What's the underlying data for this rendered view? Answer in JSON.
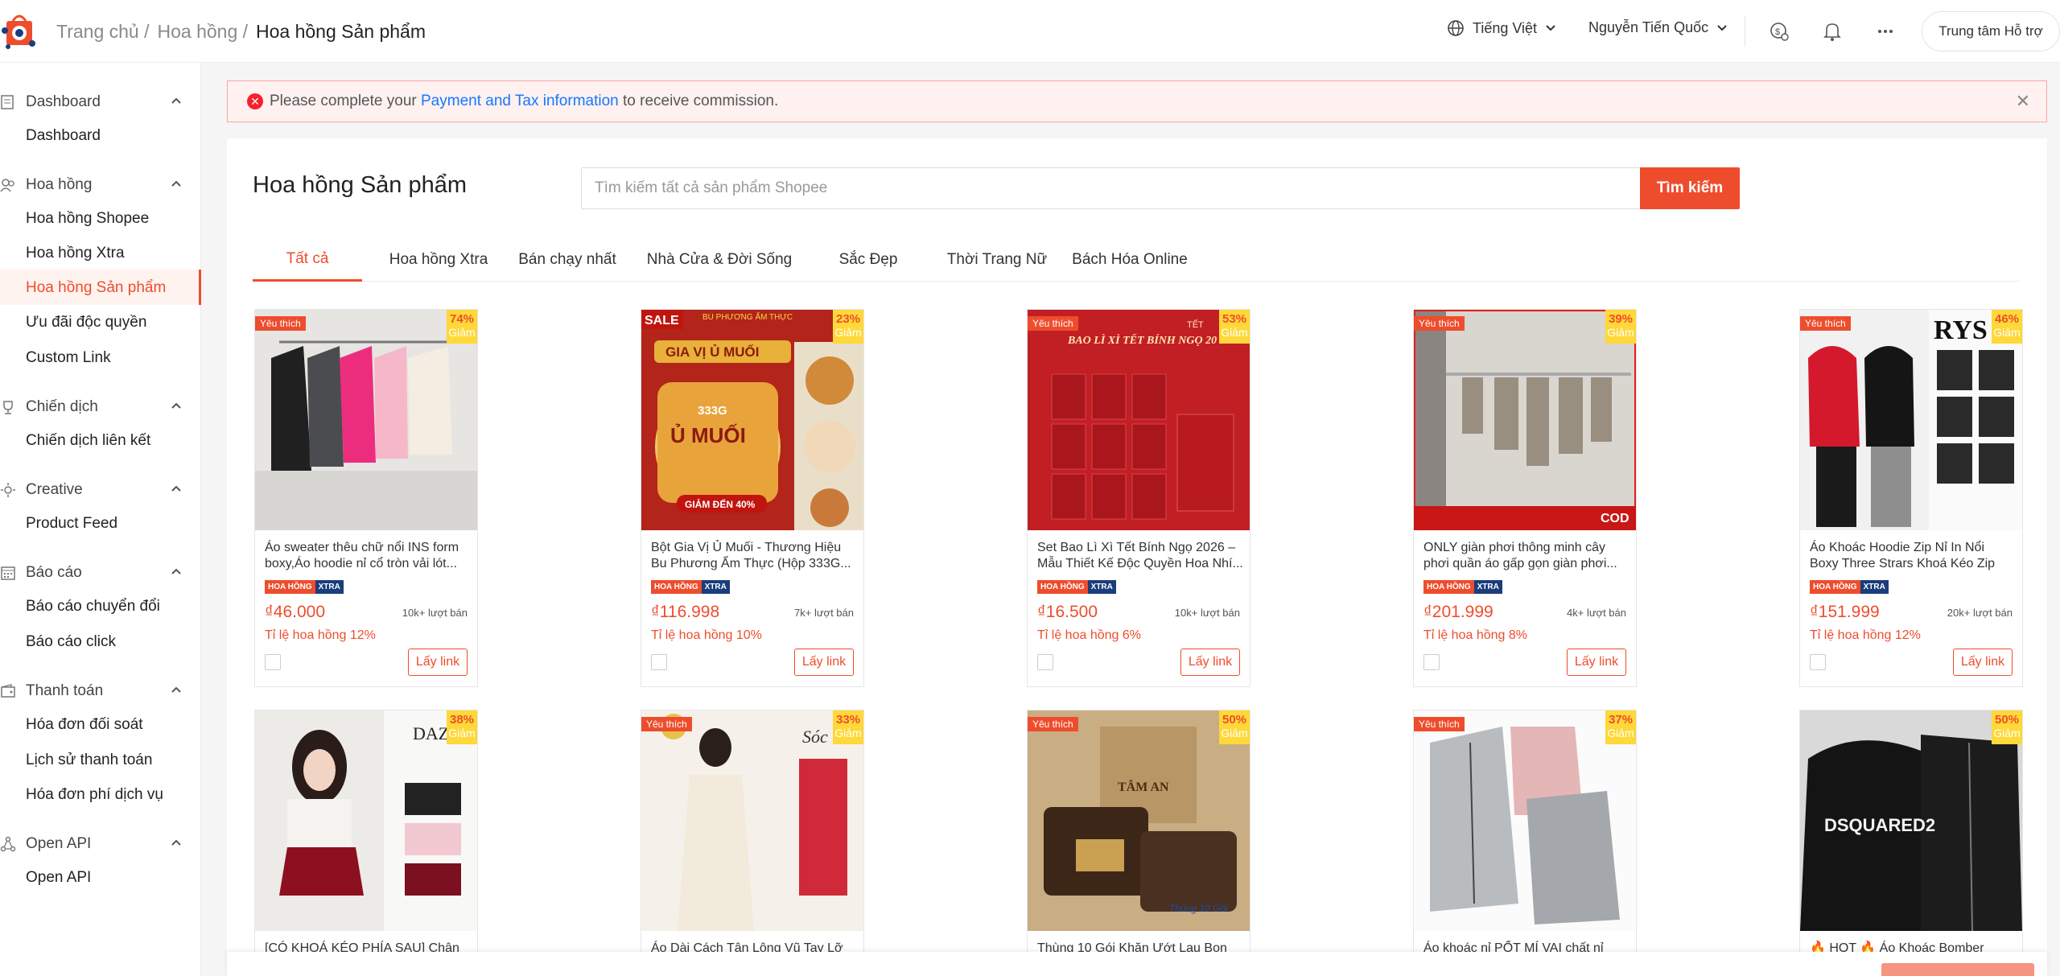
{
  "header": {
    "breadcrumb": [
      "Trang chủ /",
      "Hoa hồng /",
      "Hoa hồng Sản phẩm"
    ],
    "language": "Tiếng Việt",
    "user": "Nguyễn Tiến Quốc",
    "help": "Trung tâm Hỗ trợ"
  },
  "sidebar": {
    "sections": [
      {
        "title": "Dashboard",
        "items": [
          "Dashboard"
        ]
      },
      {
        "title": "Hoa hồng",
        "items": [
          "Hoa hồng Shopee",
          "Hoa hồng Xtra",
          "Hoa hồng Sản phẩm",
          "Ưu đãi độc quyền",
          "Custom Link"
        ]
      },
      {
        "title": "Chiến dịch",
        "items": [
          "Chiến dịch liên kết"
        ]
      },
      {
        "title": "Creative",
        "items": [
          "Product Feed"
        ]
      },
      {
        "title": "Báo cáo",
        "items": [
          "Báo cáo chuyển đổi",
          "Báo cáo click"
        ]
      },
      {
        "title": "Thanh toán",
        "items": [
          "Hóa đơn đối soát",
          "Lịch sử thanh toán",
          "Hóa đơn phí dịch vụ"
        ]
      },
      {
        "title": "Open API",
        "items": [
          "Open API"
        ]
      }
    ],
    "active_item": "Hoa hồng Sản phẩm"
  },
  "alert": {
    "prefix": "Please complete your",
    "link": "Payment and Tax information",
    "suffix": "to receive commission."
  },
  "main": {
    "title": "Hoa hồng Sản phẩm",
    "search_placeholder": "Tìm kiếm tất cả sản phẩm Shopee",
    "search_button": "Tìm kiếm",
    "tabs": [
      "Tất cả",
      "Hoa hồng Xtra",
      "Bán chạy nhất",
      "Nhà Cửa & Đời Sống",
      "Sắc Đẹp",
      "Thời Trang Nữ",
      "Bách Hóa Online"
    ],
    "active_tab": "Tất cả"
  },
  "labels": {
    "favorite": "Yêu thích",
    "discount_word": "Giảm",
    "badge_commission": "HOA HỒNG",
    "badge_xtra": "XTRA",
    "get_link": "Lấy link"
  },
  "products": [
    {
      "title": "Áo sweater thêu chữ nổi INS form boxy,Áo hoodie nỉ cổ tròn vải lót...",
      "price": "₫46.000",
      "sold": "10k+ lượt bán",
      "rate": "Tỉ lệ hoa hồng 12%",
      "discount": "74%",
      "favorite": true
    },
    {
      "title": "Bột Gia Vị Ủ Muối - Thương Hiệu Bu Phương Ẩm Thực (Hộp 333G...",
      "price": "₫116.998",
      "sold": "7k+ lượt bán",
      "rate": "Tỉ lệ hoa hồng 10%",
      "discount": "23%",
      "favorite": false
    },
    {
      "title": "Set Bao Lì Xì Tết Bính Ngọ 2026 – Mẫu Thiết Kế Độc Quyền Hoa Nhí...",
      "price": "₫16.500",
      "sold": "10k+ lượt bán",
      "rate": "Tỉ lệ hoa hồng 6%",
      "discount": "53%",
      "favorite": true
    },
    {
      "title": "ONLY giàn phơi thông minh cây phơi quần áo gấp gọn giàn phơi...",
      "price": "₫201.999",
      "sold": "4k+ lượt bán",
      "rate": "Tỉ lệ hoa hồng 8%",
      "discount": "39%",
      "favorite": true
    },
    {
      "title": "Áo Khoác Hoodie Zip Nỉ In Nổi Boxy Three Strars Khoá Kéo Zip 2...",
      "price": "₫151.999",
      "sold": "20k+ lượt bán",
      "rate": "Tỉ lệ hoa hồng 12%",
      "discount": "46%",
      "favorite": true
    },
    {
      "title": "[CÓ KHOÁ KÉO PHÍA SAU] Chân",
      "discount": "38%",
      "favorite": false
    },
    {
      "title": "Áo Dài Cách Tân Lông Vũ Tay Lỡ",
      "discount": "33%",
      "favorite": true
    },
    {
      "title": "Thùng 10 Gói Khăn Ướt Lau Bọn",
      "discount": "50%",
      "favorite": true
    },
    {
      "title": "Áo khoác nỉ PỐT MÍ VAI chất nỉ",
      "discount": "37%",
      "favorite": true
    },
    {
      "title": "🔥 HOT 🔥 Áo Khoác Bomber",
      "discount": "50%",
      "favorite": false
    }
  ],
  "image_texts": {
    "p2_sale": "SALE",
    "p2_brand": "BU PHƯƠNG ẨM THỰC",
    "p2_name": "GIA VỊ Ủ MUỐI",
    "p2_weight": "333G",
    "p2_big": "Ủ MUỐI",
    "p2_off": "GIẢM ĐẾN 40%",
    "p3_title": "BAO LÌ XÌ TẾT BÍNH NGỌ 20",
    "p3_tet": "TẾT",
    "p4_cod": "COD",
    "p5_brand": "RYS",
    "p9_brand": "TÂM AN",
    "p9_pack": "Thùng 10 Gói",
    "p10_brand": "DSQUARED2",
    "p6_brand": "DAZ",
    "p7_brand": "Sóc"
  },
  "colors": {
    "accent": "#ee4d2d",
    "link": "#1677ff",
    "xtra": "#1a3d7c",
    "discount_bg": "#ffd839"
  }
}
